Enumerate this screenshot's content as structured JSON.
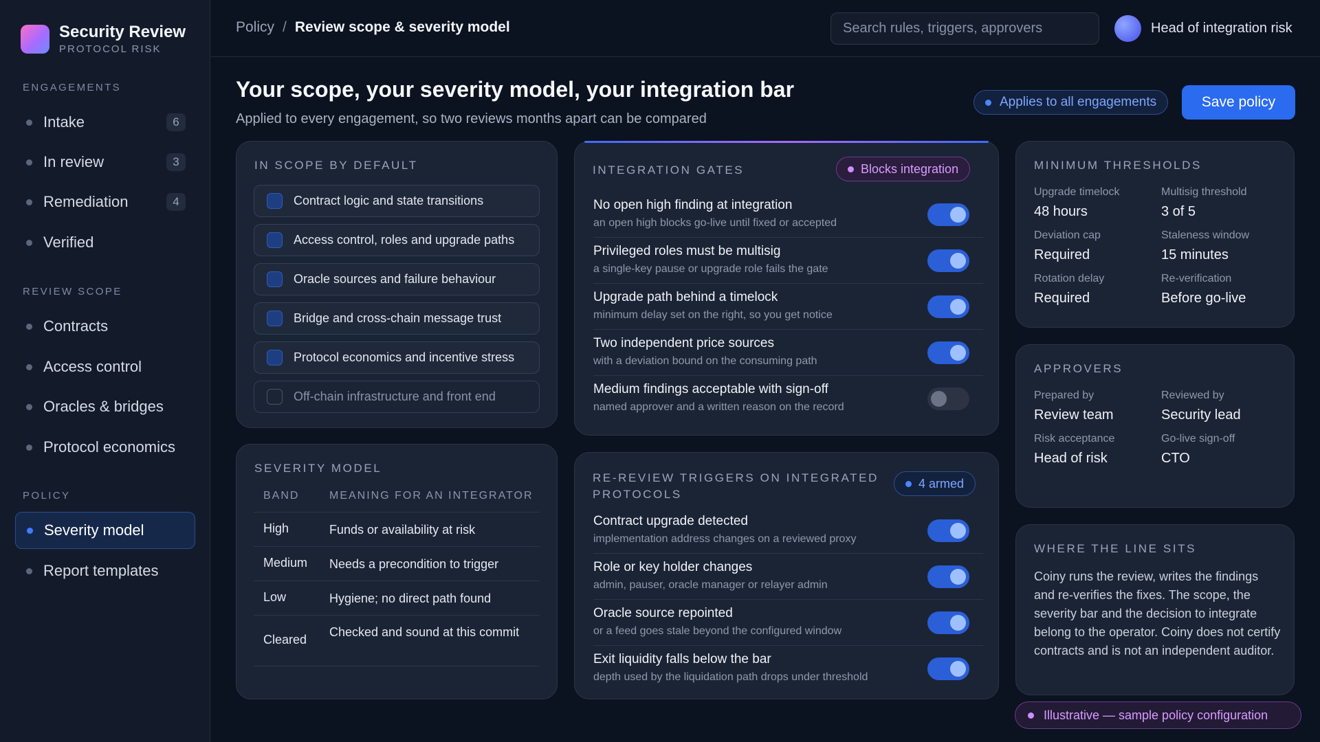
{
  "brand": {
    "title": "Security Review",
    "subtitle": "PROTOCOL RISK"
  },
  "sidebar": {
    "engagements_label": "ENGAGEMENTS",
    "engagements": [
      {
        "label": "Intake",
        "count": "6"
      },
      {
        "label": "In review",
        "count": "3"
      },
      {
        "label": "Remediation",
        "count": "4"
      },
      {
        "label": "Verified"
      }
    ],
    "scope_label": "REVIEW SCOPE",
    "scope": [
      {
        "label": "Contracts"
      },
      {
        "label": "Access control"
      },
      {
        "label": "Oracles & bridges"
      },
      {
        "label": "Protocol economics"
      }
    ],
    "policy_label": "POLICY",
    "policy": [
      {
        "label": "Severity model",
        "active": true
      },
      {
        "label": "Report templates"
      }
    ]
  },
  "topbar": {
    "breadcrumb_parent": "Policy",
    "breadcrumb_sep": "/",
    "breadcrumb_current": "Review scope & severity model",
    "search_placeholder": "Search rules, triggers, approvers",
    "user_name": "Head of integration risk"
  },
  "header": {
    "title": "Your scope, your severity model, your integration bar",
    "subtitle": "Applied to every engagement, so two reviews months apart can be compared",
    "scope_pill": "Applies to all engagements",
    "save_label": "Save policy"
  },
  "in_scope": {
    "label": "IN SCOPE BY DEFAULT",
    "items": [
      {
        "label": "Contract logic and state transitions",
        "checked": true
      },
      {
        "label": "Access control, roles and upgrade paths",
        "checked": true
      },
      {
        "label": "Oracle sources and failure behaviour",
        "checked": true
      },
      {
        "label": "Bridge and cross-chain message trust",
        "checked": true
      },
      {
        "label": "Protocol economics and incentive stress",
        "checked": true
      },
      {
        "label": "Off-chain infrastructure and front end",
        "checked": false
      }
    ]
  },
  "severity": {
    "label": "SEVERITY MODEL",
    "col_band": "BAND",
    "col_meaning": "MEANING FOR AN INTEGRATOR",
    "rows": [
      {
        "band": "High",
        "meaning": "Funds or availability at risk"
      },
      {
        "band": "Medium",
        "meaning": "Needs a precondition to trigger"
      },
      {
        "band": "Low",
        "meaning": "Hygiene; no direct path found"
      },
      {
        "band": "Cleared",
        "meaning": "Checked and sound at this commit"
      }
    ]
  },
  "gates": {
    "label": "INTEGRATION GATES",
    "badge": "Blocks integration",
    "items": [
      {
        "title": "No open high finding at integration",
        "desc": "an open high blocks go-live until fixed or accepted",
        "on": true
      },
      {
        "title": "Privileged roles must be multisig",
        "desc": "a single-key pause or upgrade role fails the gate",
        "on": true
      },
      {
        "title": "Upgrade path behind a timelock",
        "desc": "minimum delay set on the right, so you get notice",
        "on": true
      },
      {
        "title": "Two independent price sources",
        "desc": "with a deviation bound on the consuming path",
        "on": true
      },
      {
        "title": "Medium findings acceptable with sign-off",
        "desc": "named approver and a written reason on the record",
        "on": false
      }
    ]
  },
  "triggers": {
    "label_line1": "RE-REVIEW TRIGGERS ON INTEGRATED",
    "label_line2": "PROTOCOLS",
    "badge": "4 armed",
    "items": [
      {
        "title": "Contract upgrade detected",
        "desc": "implementation address changes on a reviewed proxy",
        "on": true
      },
      {
        "title": "Role or key holder changes",
        "desc": "admin, pauser, oracle manager or relayer admin",
        "on": true
      },
      {
        "title": "Oracle source repointed",
        "desc": "or a feed goes stale beyond the configured window",
        "on": true
      },
      {
        "title": "Exit liquidity falls below the bar",
        "desc": "depth used by the liquidation path drops under threshold",
        "on": true
      }
    ]
  },
  "thresholds": {
    "label": "MINIMUM THRESHOLDS",
    "items": [
      {
        "key": "Upgrade timelock",
        "value": "48 hours"
      },
      {
        "key": "Multisig threshold",
        "value": "3 of 5"
      },
      {
        "key": "Deviation cap",
        "value": "Required"
      },
      {
        "key": "Staleness window",
        "value": "15 minutes"
      },
      {
        "key": "Rotation delay",
        "value": "Required"
      },
      {
        "key": "Re-verification",
        "value": "Before go-live"
      }
    ]
  },
  "approvers": {
    "label": "APPROVERS",
    "items": [
      {
        "key": "Prepared by",
        "value": "Review team"
      },
      {
        "key": "Reviewed by",
        "value": "Security lead"
      },
      {
        "key": "Risk acceptance",
        "value": "Head of risk"
      },
      {
        "key": "Go-live sign-off",
        "value": "CTO"
      }
    ]
  },
  "line": {
    "label": "WHERE THE LINE SITS",
    "text": "Coiny runs the review, writes the findings and re-verifies the fixes. The scope, the severity bar and the decision to integrate belong to the operator. Coiny does not certify contracts and is not an independent auditor."
  },
  "footer_badge": "Illustrative — sample policy configuration",
  "colors": {
    "accent": "#2a6bf0",
    "violet": "#d08cff",
    "background": "#0b1220"
  }
}
